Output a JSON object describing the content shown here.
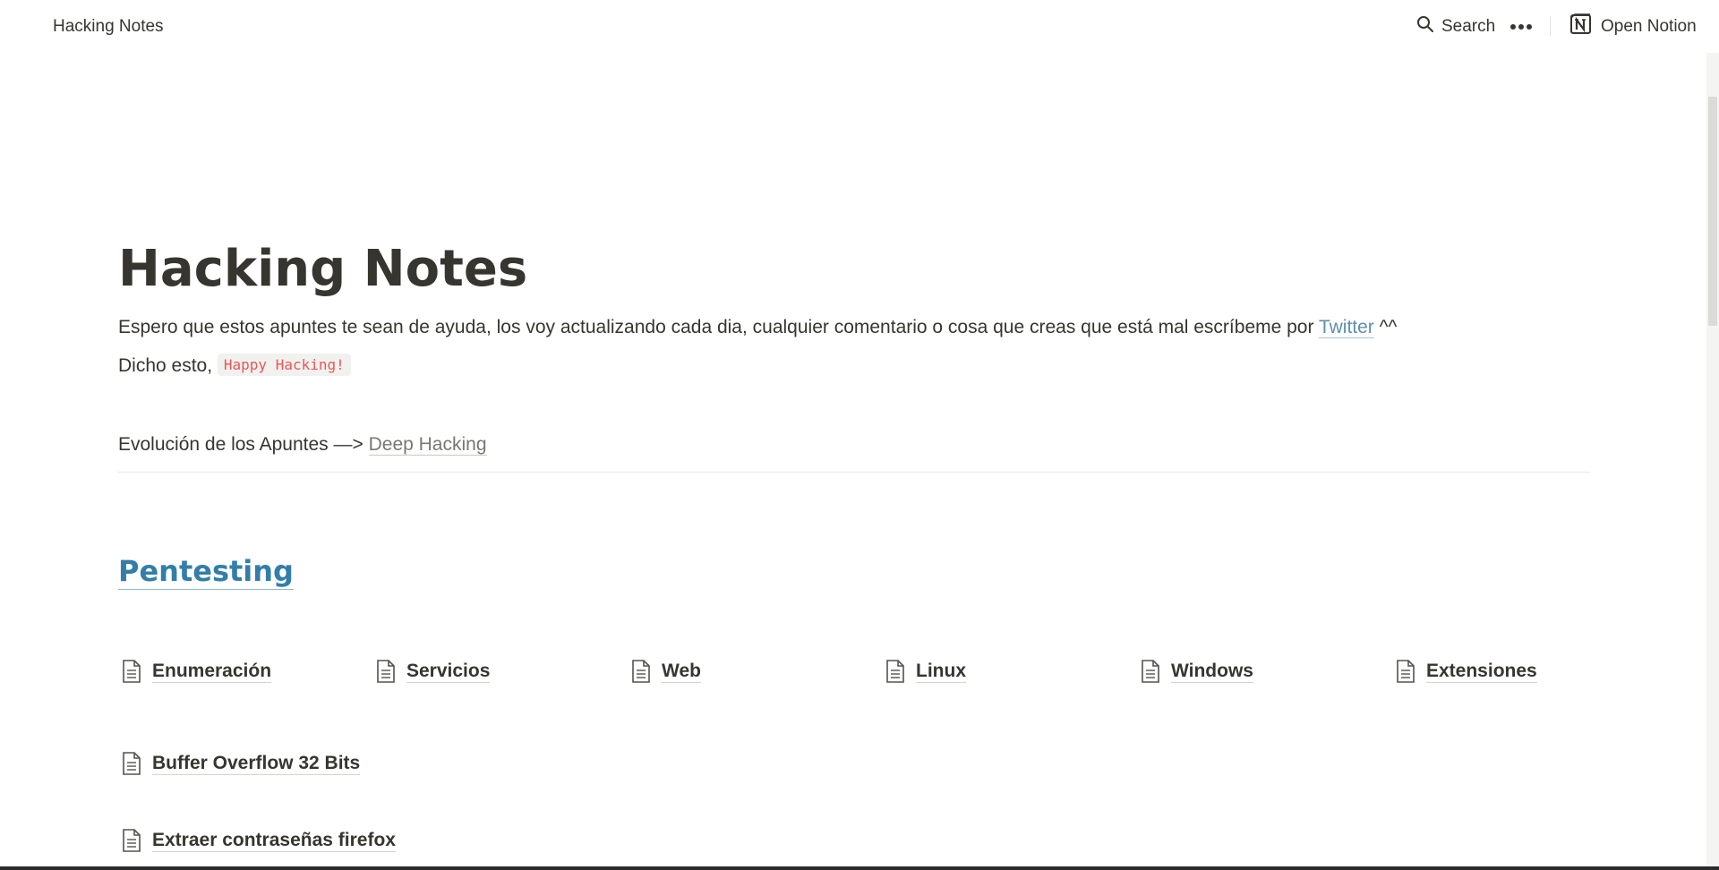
{
  "topbar": {
    "title": "Hacking Notes",
    "search_label": "Search",
    "open_notion_label": "Open Notion"
  },
  "page": {
    "title": "Hacking Notes",
    "intro_text": "Espero que estos apuntes te sean de ayuda, los voy actualizando cada dia, cualquier comentario o cosa que creas que está mal escríbeme por ",
    "twitter_link": "Twitter",
    "intro_suffix": " ^^",
    "dicho_text": "Dicho esto, ",
    "happy_hacking_code": "Happy Hacking!",
    "evolution_text": "Evolución de los Apuntes —> ",
    "deep_hacking_link": "Deep Hacking"
  },
  "section": {
    "title": "Pentesting",
    "pages": [
      {
        "label": "Enumeración"
      },
      {
        "label": "Servicios"
      },
      {
        "label": "Web"
      },
      {
        "label": "Linux"
      },
      {
        "label": "Windows"
      },
      {
        "label": "Extensiones"
      },
      {
        "label": "Buffer Overflow 32 Bits"
      },
      {
        "label": "Extraer contraseñas firefox"
      }
    ]
  },
  "colors": {
    "text": "#37352f",
    "link_blue": "#337ea9",
    "code_red": "#eb5757",
    "code_bg": "#f1f1ef"
  }
}
